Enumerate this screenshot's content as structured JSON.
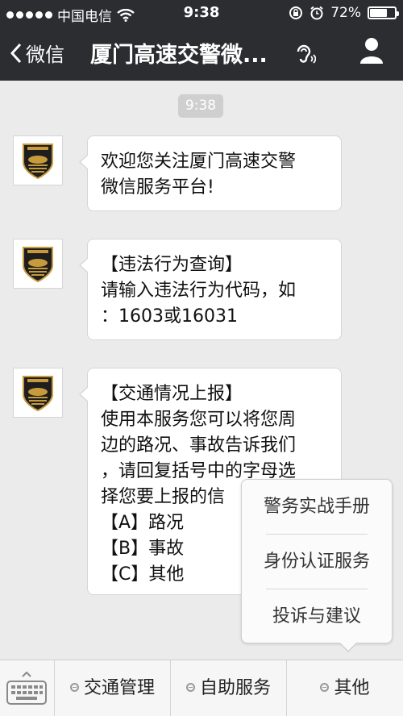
{
  "status_bar": {
    "carrier": "中国电信",
    "time": "9:38",
    "battery": "72%",
    "battery_level": 0.72
  },
  "nav": {
    "back_label": "微信",
    "title": "厦门高速交警微..."
  },
  "chat": {
    "timestamp": "9:38",
    "messages": [
      {
        "lines": [
          "欢迎您关注厦门高速交警",
          "微信服务平台!"
        ]
      },
      {
        "lines": [
          "【违法行为查询】",
          "请输入违法行为代码，如",
          "：1603或16031"
        ]
      },
      {
        "lines": [
          "【交通情况上报】",
          "使用本服务您可以将您周",
          "边的路况、事故告诉我们",
          "，请回复括号中的字母选",
          "择您要上报的信",
          "【A】路况",
          "【B】事故",
          "【C】其他"
        ]
      }
    ]
  },
  "popup_menu": {
    "items": [
      "警务实战手册",
      "身份认证服务",
      "投诉与建议"
    ]
  },
  "bottom_menu": {
    "items": [
      "交通管理",
      "自助服务",
      "其他"
    ]
  }
}
